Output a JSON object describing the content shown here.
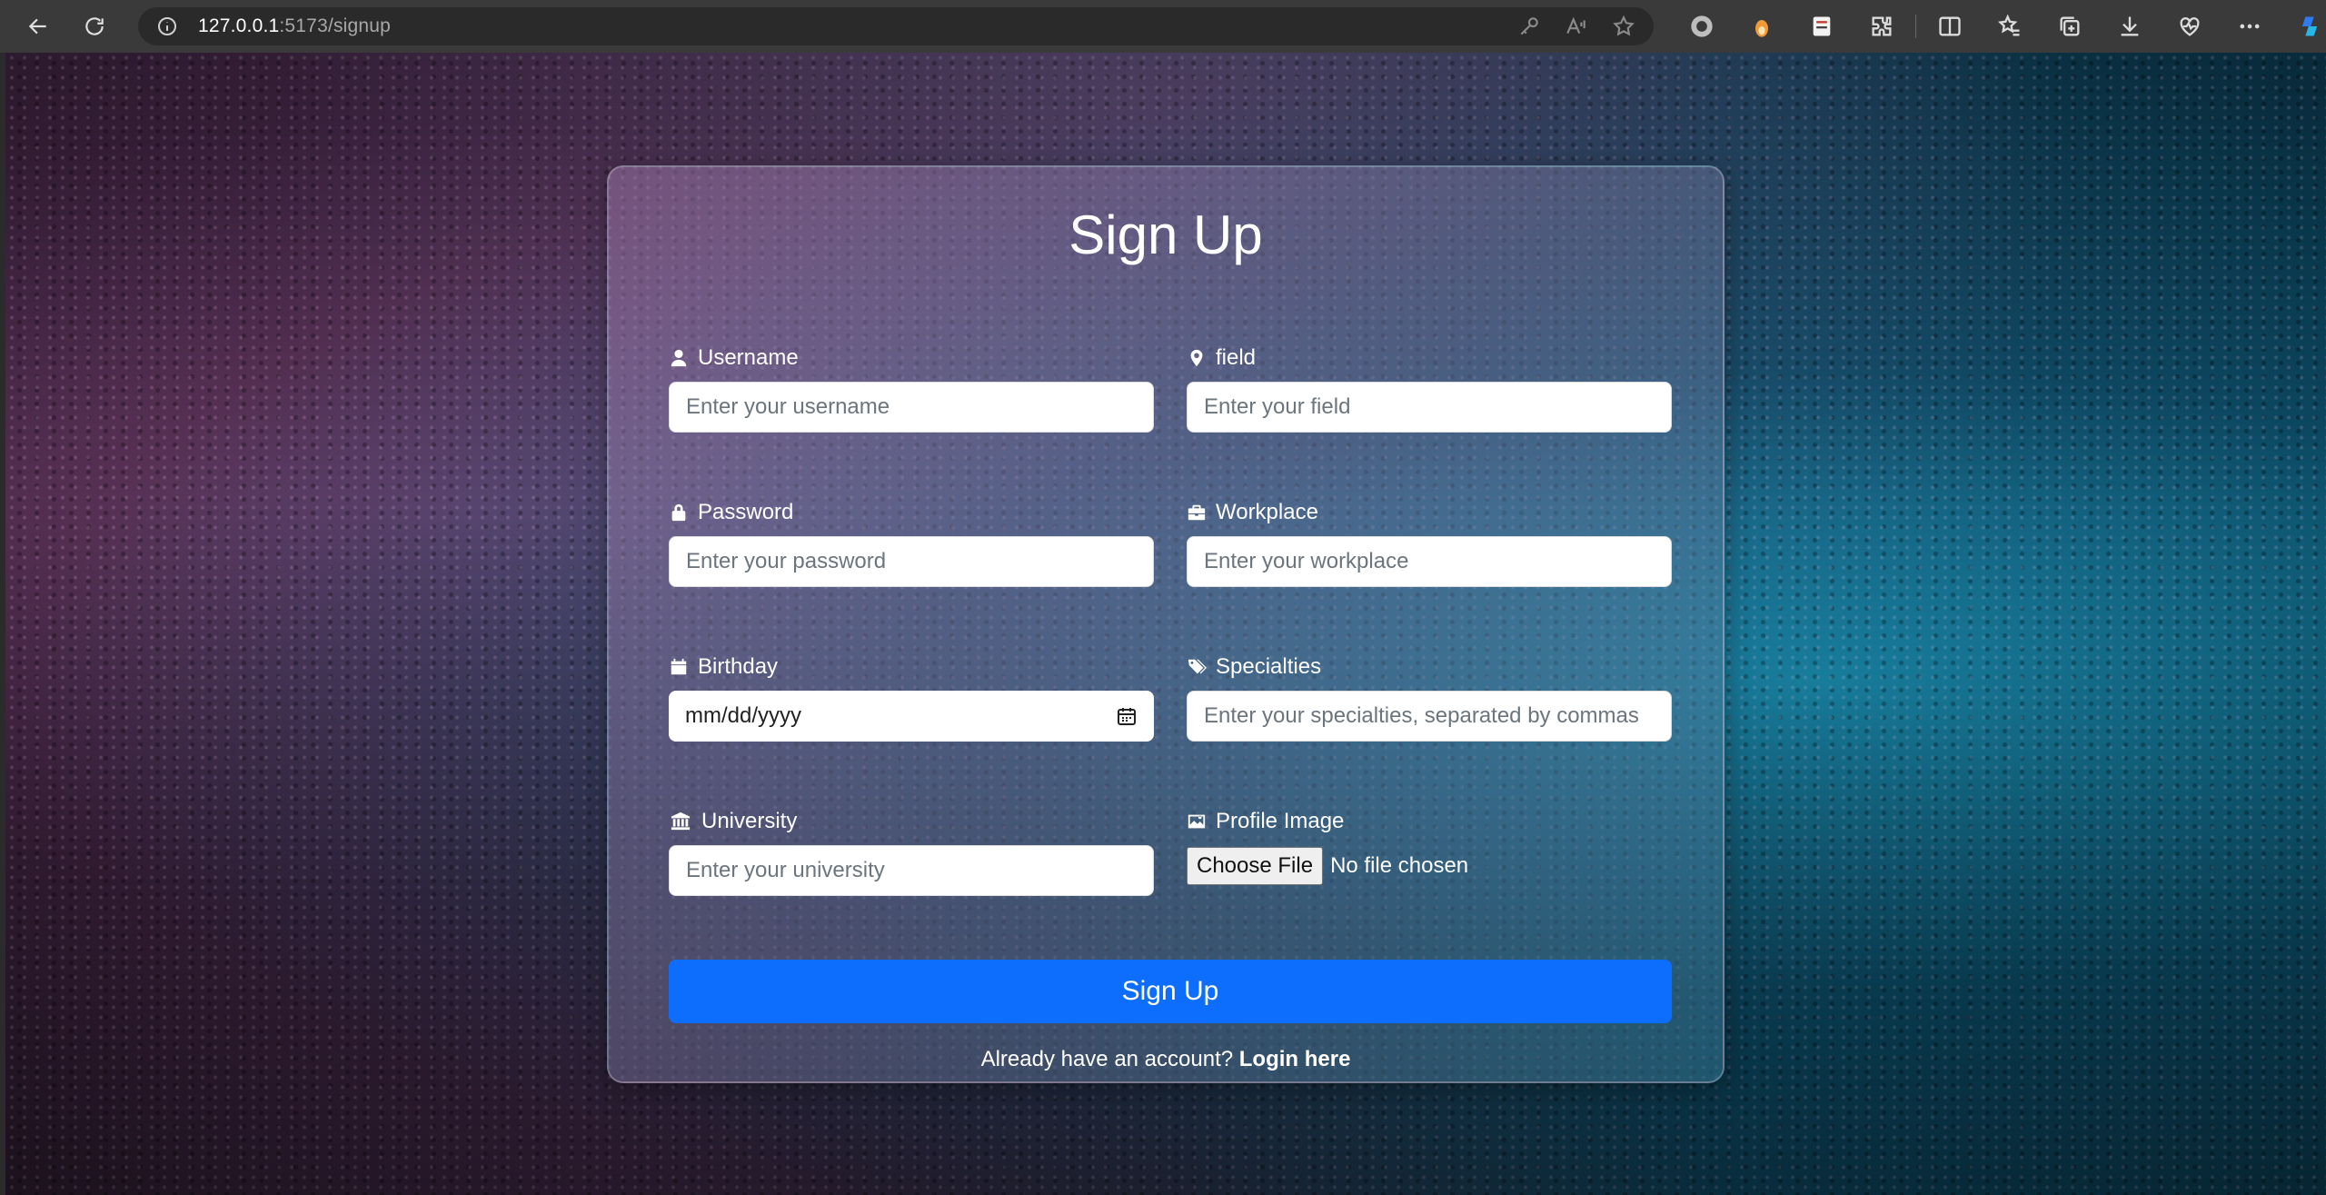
{
  "browser": {
    "url_host": "127.0.0.1",
    "url_path": ":5173/signup"
  },
  "form": {
    "title": "Sign Up",
    "fields": {
      "username": {
        "label": "Username",
        "placeholder": "Enter your username"
      },
      "field": {
        "label": "field",
        "placeholder": "Enter your field"
      },
      "password": {
        "label": "Password",
        "placeholder": "Enter your password"
      },
      "workplace": {
        "label": "Workplace",
        "placeholder": "Enter your workplace"
      },
      "birthday": {
        "label": "Birthday",
        "value": "mm/dd/yyyy"
      },
      "specialties": {
        "label": "Specialties",
        "placeholder": "Enter your specialties, separated by commas"
      },
      "university": {
        "label": "University",
        "placeholder": "Enter your university"
      },
      "profile_image": {
        "label": "Profile Image",
        "button": "Choose File",
        "status": "No file chosen"
      }
    },
    "submit_label": "Sign Up",
    "footer_text": "Already have an account?",
    "footer_link": "Login here"
  },
  "colors": {
    "primary": "#0d6efd"
  }
}
